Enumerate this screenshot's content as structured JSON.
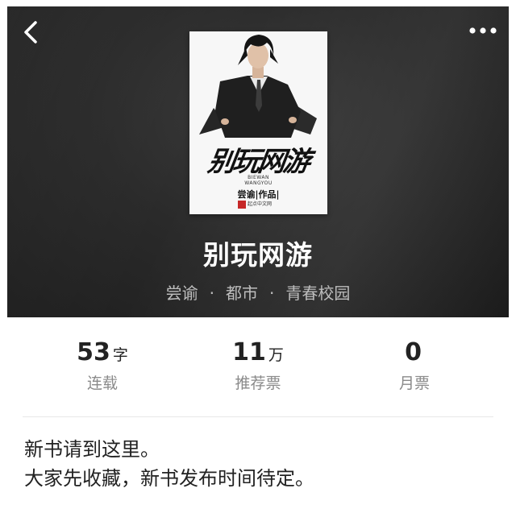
{
  "header": {
    "back_icon": "chevron-left-icon",
    "more_icon": "more-dots-icon"
  },
  "book": {
    "title": "别玩网游",
    "author": "尝谕",
    "separator": "·",
    "category": "都市",
    "subcategory": "青春校园",
    "cover": {
      "title": "别玩网游",
      "pinyin_line1": "BIEWAN",
      "pinyin_line2": "WANGYOU",
      "byline": "尝谕|作品|",
      "publisher": "起点中文网"
    }
  },
  "stats": [
    {
      "value": "53",
      "unit": "字",
      "label": "连载"
    },
    {
      "value": "11",
      "unit": "万",
      "label": "推荐票"
    },
    {
      "value": "0",
      "unit": "",
      "label": "月票"
    }
  ],
  "description": {
    "line1": "新书请到这里。",
    "line2": "大家先收藏，新书发布时间待定。"
  },
  "colors": {
    "hero_bg": "#2a2a2a",
    "title_text": "#ffffff",
    "meta_text": "#bdbdbd",
    "label_text": "#8a8a8a"
  }
}
